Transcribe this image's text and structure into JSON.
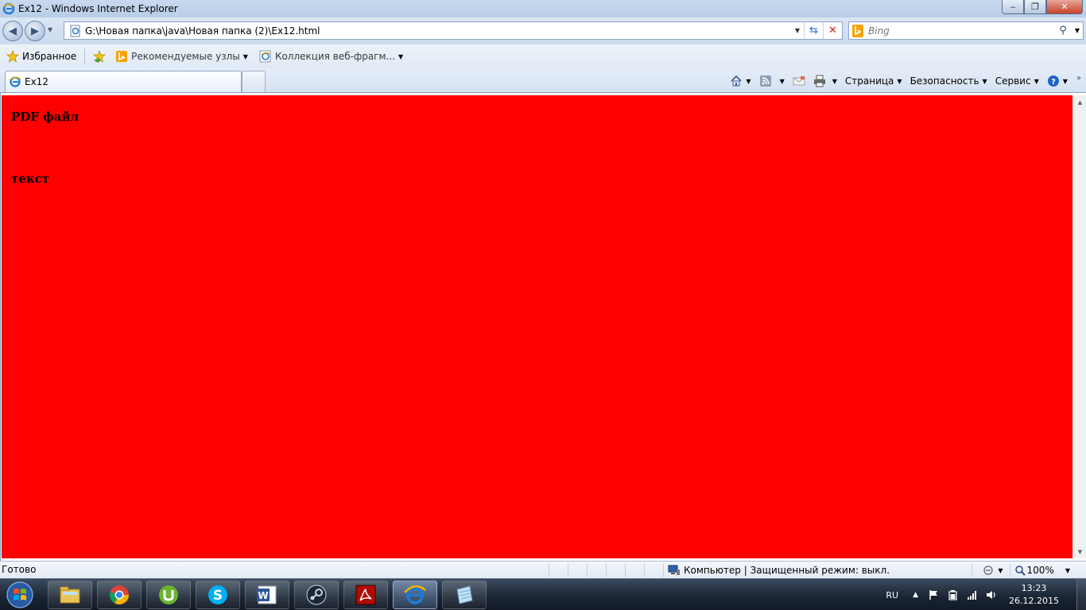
{
  "window": {
    "title": "Ex12 - Windows Internet Explorer",
    "controls": {
      "minimize": "‒",
      "maximize": "❐",
      "close": "✕"
    }
  },
  "address_bar": {
    "url": "G:\\Новая папка\\java\\Новая папка (2)\\Ex12.html",
    "search_placeholder": "Bing"
  },
  "favorites_bar": {
    "favorites_label": "Избранное",
    "items": [
      {
        "label": "Рекомендуемые узлы",
        "icon": "bing-icon"
      },
      {
        "label": "Коллекция веб-фрагм...",
        "icon": "ie-icon"
      }
    ]
  },
  "tabs": [
    {
      "label": "Ex12",
      "active": true
    }
  ],
  "command_bar": {
    "page_label": "Страница",
    "safety_label": "Безопасность",
    "tools_label": "Сервис"
  },
  "page": {
    "background": "#ff0000",
    "headings": [
      "PDF файл",
      "текст"
    ]
  },
  "status_bar": {
    "status": "Готово",
    "zone": "Компьютер | Защищенный режим: выкл.",
    "zoom": "100%"
  },
  "taskbar": {
    "apps": [
      {
        "name": "explorer",
        "icon": "folder-icon"
      },
      {
        "name": "chrome",
        "icon": "chrome-icon"
      },
      {
        "name": "utorrent",
        "icon": "utorrent-icon"
      },
      {
        "name": "skype",
        "icon": "skype-icon"
      },
      {
        "name": "word",
        "icon": "word-icon"
      },
      {
        "name": "steam",
        "icon": "steam-icon"
      },
      {
        "name": "acrobat",
        "icon": "acrobat-icon"
      },
      {
        "name": "internet-explorer",
        "icon": "ie-icon",
        "active": true
      },
      {
        "name": "notepad",
        "icon": "notepad-icon"
      }
    ],
    "tray": {
      "language": "RU",
      "time": "13:23",
      "date": "26.12.2015"
    }
  }
}
